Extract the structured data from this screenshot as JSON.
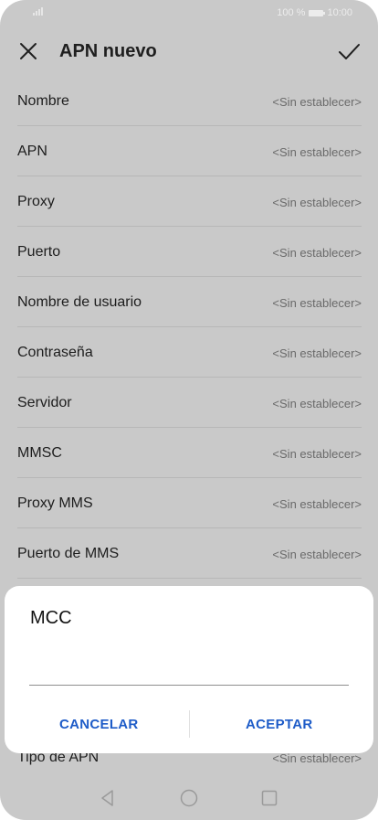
{
  "status": {
    "battery": "100 %",
    "time": "10:00"
  },
  "header": {
    "title": "APN nuevo"
  },
  "fields": [
    {
      "label": "Nombre",
      "value": "<Sin establecer>"
    },
    {
      "label": "APN",
      "value": "<Sin establecer>"
    },
    {
      "label": "Proxy",
      "value": "<Sin establecer>"
    },
    {
      "label": "Puerto",
      "value": "<Sin establecer>"
    },
    {
      "label": "Nombre de usuario",
      "value": "<Sin establecer>"
    },
    {
      "label": "Contraseña",
      "value": "<Sin establecer>"
    },
    {
      "label": "Servidor",
      "value": "<Sin establecer>"
    },
    {
      "label": "MMSC",
      "value": "<Sin establecer>"
    },
    {
      "label": "Proxy MMS",
      "value": "<Sin establecer>"
    },
    {
      "label": "Puerto de MMS",
      "value": "<Sin establecer>"
    },
    {
      "label": "Tipo de APN",
      "value": "<Sin establecer>"
    }
  ],
  "dialog": {
    "title": "MCC",
    "input_value": "",
    "cancel_label": "CANCELAR",
    "ok_label": "ACEPTAR"
  },
  "icons": {
    "close": "close-icon",
    "confirm": "check-icon",
    "back": "nav-back-icon",
    "home": "nav-home-icon",
    "recents": "nav-recents-icon"
  },
  "colors": {
    "accent": "#1e5cc8",
    "scrim_background": "#c9c9c9",
    "dialog_background": "#ffffff"
  }
}
